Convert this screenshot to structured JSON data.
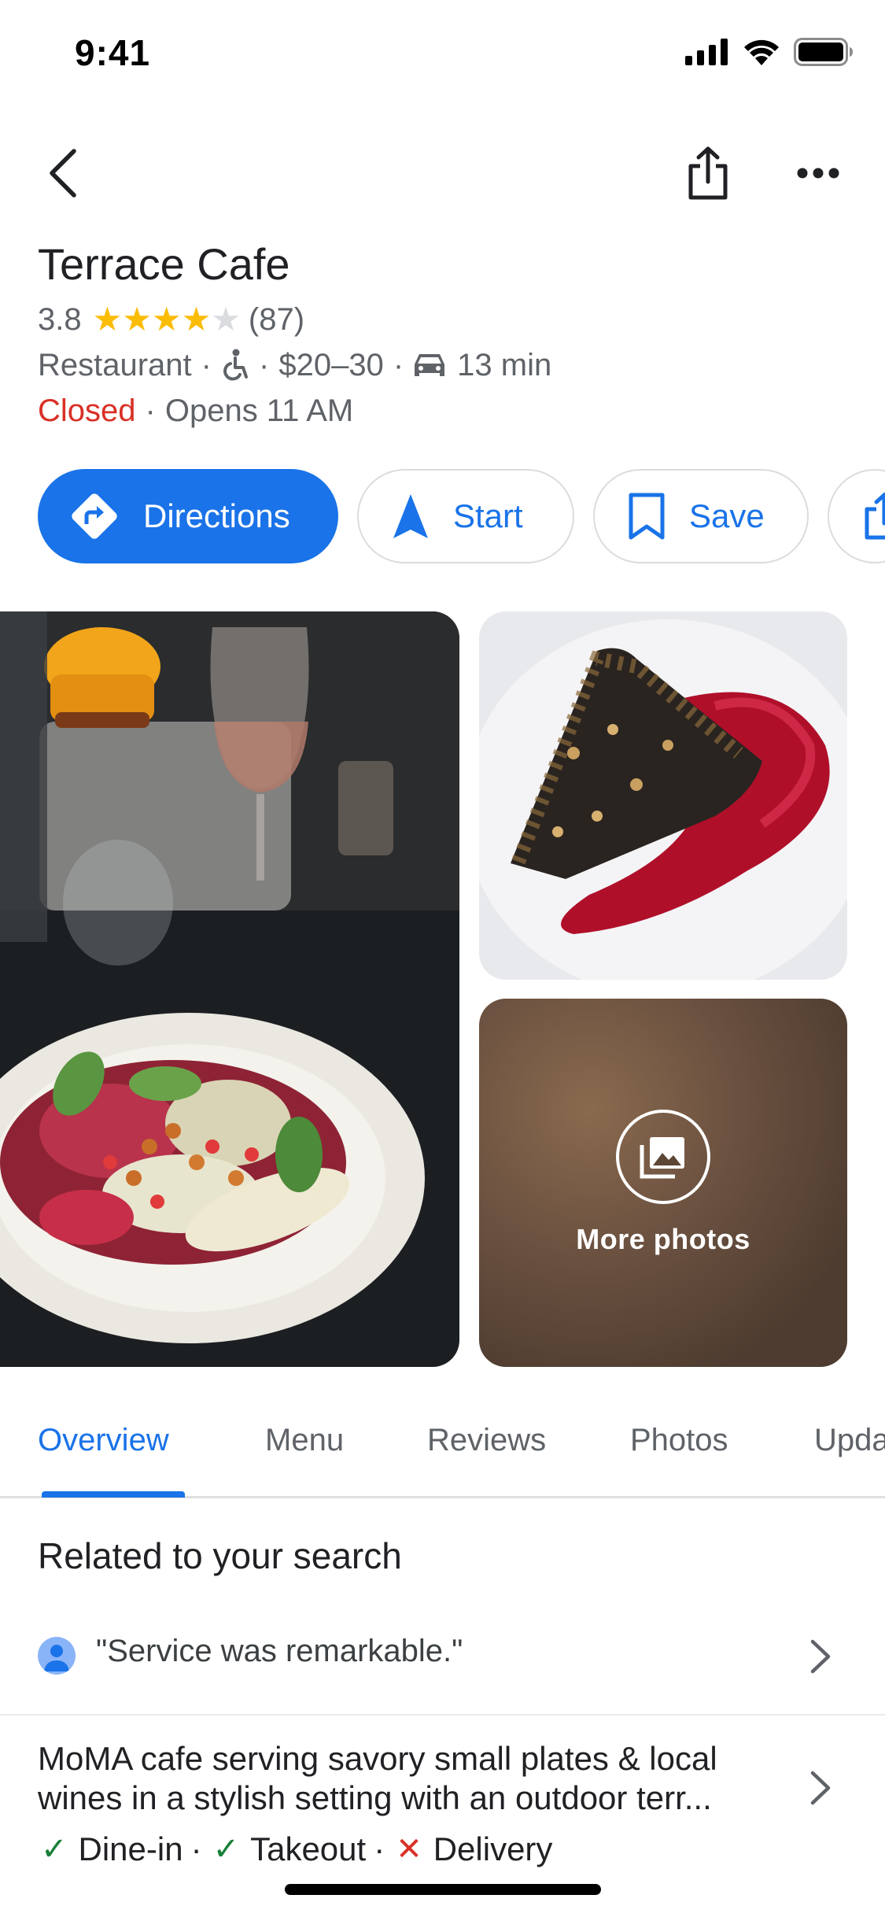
{
  "status_bar": {
    "time": "9:41"
  },
  "place": {
    "title": "Terrace Cafe",
    "rating": "3.8",
    "stars_filled": 4,
    "review_count": "(87)",
    "category": "Restaurant",
    "price": "$20–30",
    "drive_time": "13 min",
    "status": "Closed",
    "opens": "Opens 11 AM"
  },
  "actions": {
    "directions": "Directions",
    "start": "Start",
    "save": "Save"
  },
  "photos": {
    "more_label": "More photos"
  },
  "tabs": [
    {
      "label": "Overview"
    },
    {
      "label": "Menu"
    },
    {
      "label": "Reviews"
    },
    {
      "label": "Photos"
    },
    {
      "label": "Upda"
    }
  ],
  "related": {
    "title": "Related to your search",
    "review_snippet": "\"Service was remarkable.\"",
    "description_line1": "MoMA cafe serving savory small plates & local",
    "description_line2": "wines in a stylish setting with an outdoor terr...",
    "services": [
      {
        "label": "Dine-in",
        "available": true
      },
      {
        "label": "Takeout",
        "available": true
      },
      {
        "label": "Delivery",
        "available": false
      }
    ]
  },
  "colors": {
    "accent": "#1a73e8",
    "closed": "#d93025",
    "available": "#188038",
    "star": "#fbbc04"
  }
}
